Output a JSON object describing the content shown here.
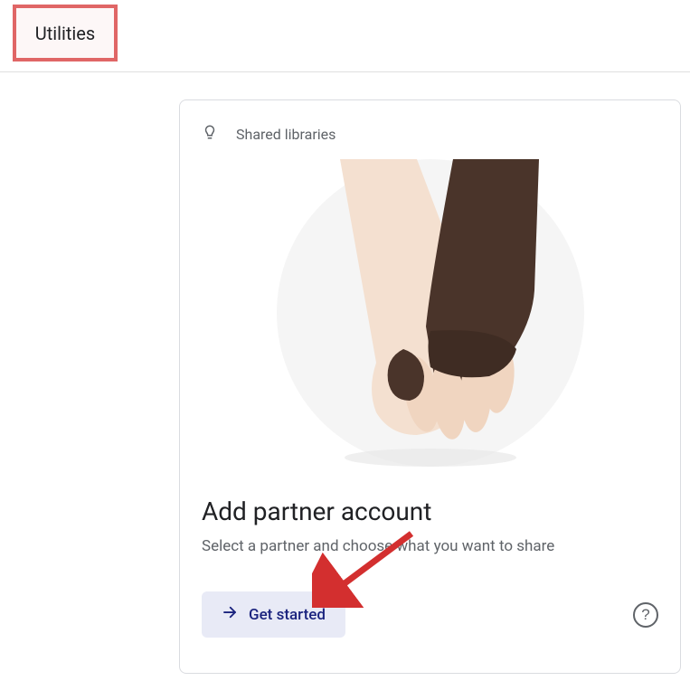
{
  "header": {
    "title": "Utilities"
  },
  "card": {
    "header_label": "Shared libraries",
    "title": "Add partner account",
    "subtitle": "Select a partner and choose what you want to share",
    "get_started_label": "Get started"
  }
}
